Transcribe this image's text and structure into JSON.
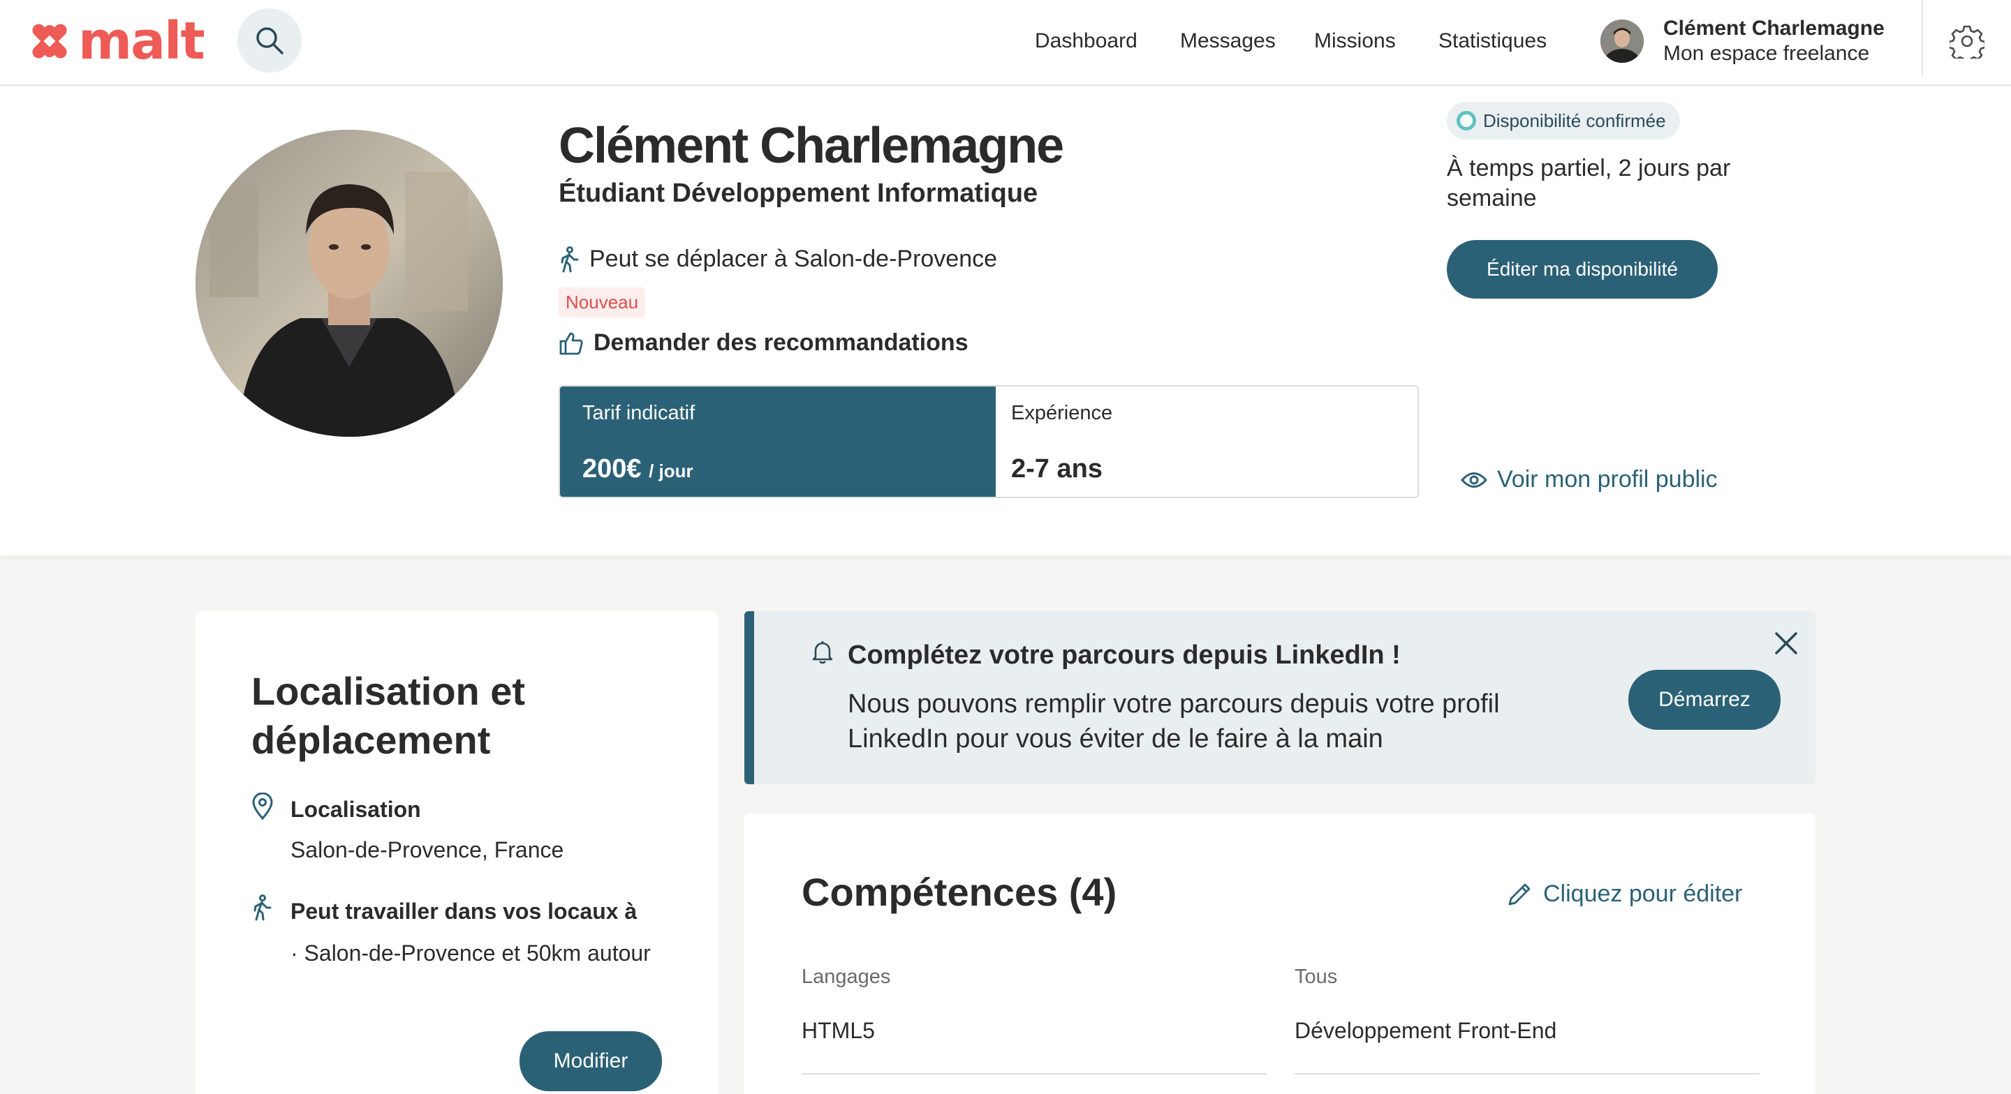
{
  "header": {
    "logo_text": "malt",
    "nav": [
      "Dashboard",
      "Messages",
      "Missions",
      "Statistiques"
    ],
    "user_name": "Clément Charlemagne",
    "user_subtitle": "Mon espace freelance"
  },
  "profile": {
    "name": "Clément Charlemagne",
    "title": "Étudiant Développement Informatique",
    "travel": "Peut se déplacer à Salon-de-Provence",
    "new_badge": "Nouveau",
    "recommendations": "Demander des recommandations",
    "rate_label": "Tarif indicatif",
    "rate_value": "200€",
    "rate_unit": "/ jour",
    "experience_label": "Expérience",
    "experience_value": "2-7 ans"
  },
  "availability": {
    "badge": "Disponibilité confirmée",
    "text": "À temps partiel, 2 jours par semaine",
    "edit_button": "Éditer ma disponibilité",
    "public_link": "Voir mon profil public"
  },
  "location_card": {
    "title": "Localisation et déplacement",
    "location_label": "Localisation",
    "location_value": "Salon-de-Provence, France",
    "work_label": "Peut travailler dans vos locaux à",
    "work_value": "· Salon-de-Provence et 50km autour",
    "modify_button": "Modifier"
  },
  "linkedin_banner": {
    "title": "Complétez votre parcours depuis LinkedIn !",
    "text": "Nous pouvons remplir votre parcours depuis votre profil LinkedIn pour vous éviter de le faire à la main",
    "button": "Démarrez"
  },
  "skills": {
    "title": "Compétences (4)",
    "edit_link": "Cliquez pour éditer",
    "columns": [
      {
        "header": "Langages",
        "value": "HTML5"
      },
      {
        "header": "Tous",
        "value": "Développement Front-End"
      }
    ]
  },
  "colors": {
    "brand": "#ee5a55",
    "primary": "#2b6176",
    "availability_dot": "#5fc2bd"
  }
}
